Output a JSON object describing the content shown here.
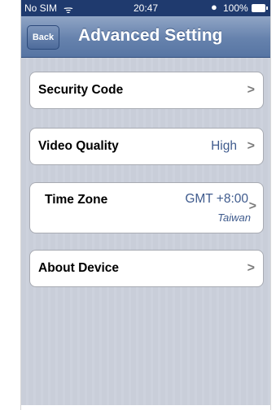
{
  "status_bar": {
    "carrier": "No SIM",
    "wifi_icon": "wifi-icon",
    "time": "20:47",
    "alarm_icon": "alarm-icon",
    "battery_text": "100%",
    "battery_icon": "battery-icon"
  },
  "nav": {
    "back_label": "Back",
    "title": "Advanced Setting"
  },
  "rows": [
    {
      "label": "Security Code",
      "value": "",
      "sub": ""
    },
    {
      "label": "Video Quality",
      "value": "High",
      "sub": ""
    },
    {
      "label": "Time Zone",
      "value": "GMT +8:00",
      "sub": "Taiwan"
    },
    {
      "label": "About Device",
      "value": "",
      "sub": ""
    }
  ],
  "colors": {
    "nav_bar": "#6682ad",
    "value_text": "#3f5b8d",
    "background": "#c9ced9"
  }
}
